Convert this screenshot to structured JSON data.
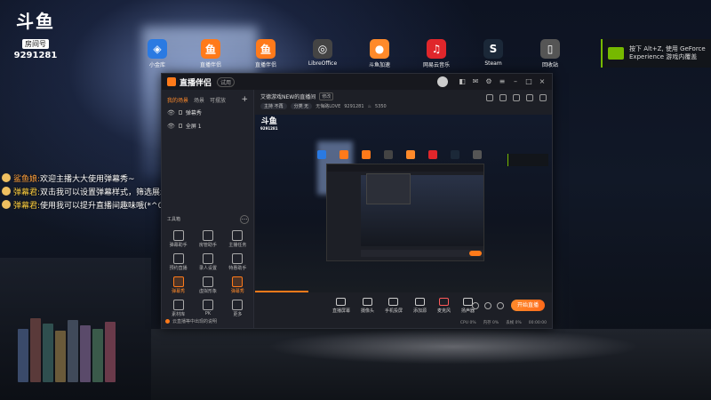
{
  "douyu": {
    "logo": "斗鱼",
    "tag": "房间号",
    "room": "9291281"
  },
  "desktop_icons": [
    {
      "label": "小金库",
      "color": "#2a7ae2",
      "glyph": "◈"
    },
    {
      "label": "直播伴侣",
      "color": "#ff7a1a",
      "glyph": "鱼"
    },
    {
      "label": "直播伴侣",
      "color": "#ff7a1a",
      "glyph": "鱼"
    },
    {
      "label": "LibreOffice",
      "color": "#444",
      "glyph": "◎"
    },
    {
      "label": "斗鱼加速",
      "color": "#ff8a2a",
      "glyph": "●"
    },
    {
      "label": "网易云音乐",
      "color": "#e0262b",
      "glyph": "♫"
    },
    {
      "label": "Steam",
      "color": "#1b2838",
      "glyph": "S"
    },
    {
      "label": "回收站",
      "color": "#555",
      "glyph": "▯"
    }
  ],
  "toast": {
    "line1": "按下 Alt+Z, 使用 GeForce",
    "line2": "Experience 游戏内覆盖"
  },
  "chat": [
    {
      "name": "鲨鱼娘:",
      "text": "欢迎主播大大使用弹幕秀~"
    },
    {
      "name": "弹幕君:",
      "text": "双击我可以设置弹幕样式，筛选展示哦~"
    },
    {
      "name": "弹幕君:",
      "text": "使用我可以提升直播间趣味哦(*^0^*)"
    }
  ],
  "app": {
    "title": "直播伴侣",
    "version": "试用",
    "tabs": [
      "我的场景",
      "场景",
      "可摆放"
    ],
    "plus": "+",
    "scenes": [
      {
        "label": "弹幕秀"
      },
      {
        "label": "全屏 1"
      }
    ],
    "tools_label": "工具箱",
    "tools_more": "···",
    "tools": [
      {
        "label": "弹幕助手",
        "orange": false
      },
      {
        "label": "房管助手",
        "orange": false
      },
      {
        "label": "主播任务",
        "orange": false
      },
      {
        "label": "预约直播",
        "orange": false
      },
      {
        "label": "录人设置",
        "orange": false
      },
      {
        "label": "特惠助手",
        "orange": false
      },
      {
        "label": "弹幕秀",
        "orange": true
      },
      {
        "label": "虚拟形象",
        "orange": false
      },
      {
        "label": "弹幕秀",
        "orange": true
      },
      {
        "label": "素材库",
        "orange": false
      },
      {
        "label": "PK",
        "orange": false
      },
      {
        "label": "更多",
        "orange": false
      }
    ],
    "left_footer": "云直播等中出现的说明",
    "stream_title": "艾德游戏NEW的直播间",
    "edit": "修改",
    "chips": [
      "主持 不再",
      "分类 无"
    ],
    "room_info": "无悔路LOVE",
    "room_id": "9291281",
    "viewers": "5350",
    "controls": [
      {
        "label": "直播屏幕"
      },
      {
        "label": "摄像头"
      },
      {
        "label": "手机投屏"
      },
      {
        "label": "添加源"
      },
      {
        "label": "麦克风"
      },
      {
        "label": "扬声器"
      }
    ],
    "start_button": "开始直播",
    "status": [
      "CPU 0%",
      "内存 0%",
      "丢帧 0%",
      "00:00:00"
    ]
  }
}
